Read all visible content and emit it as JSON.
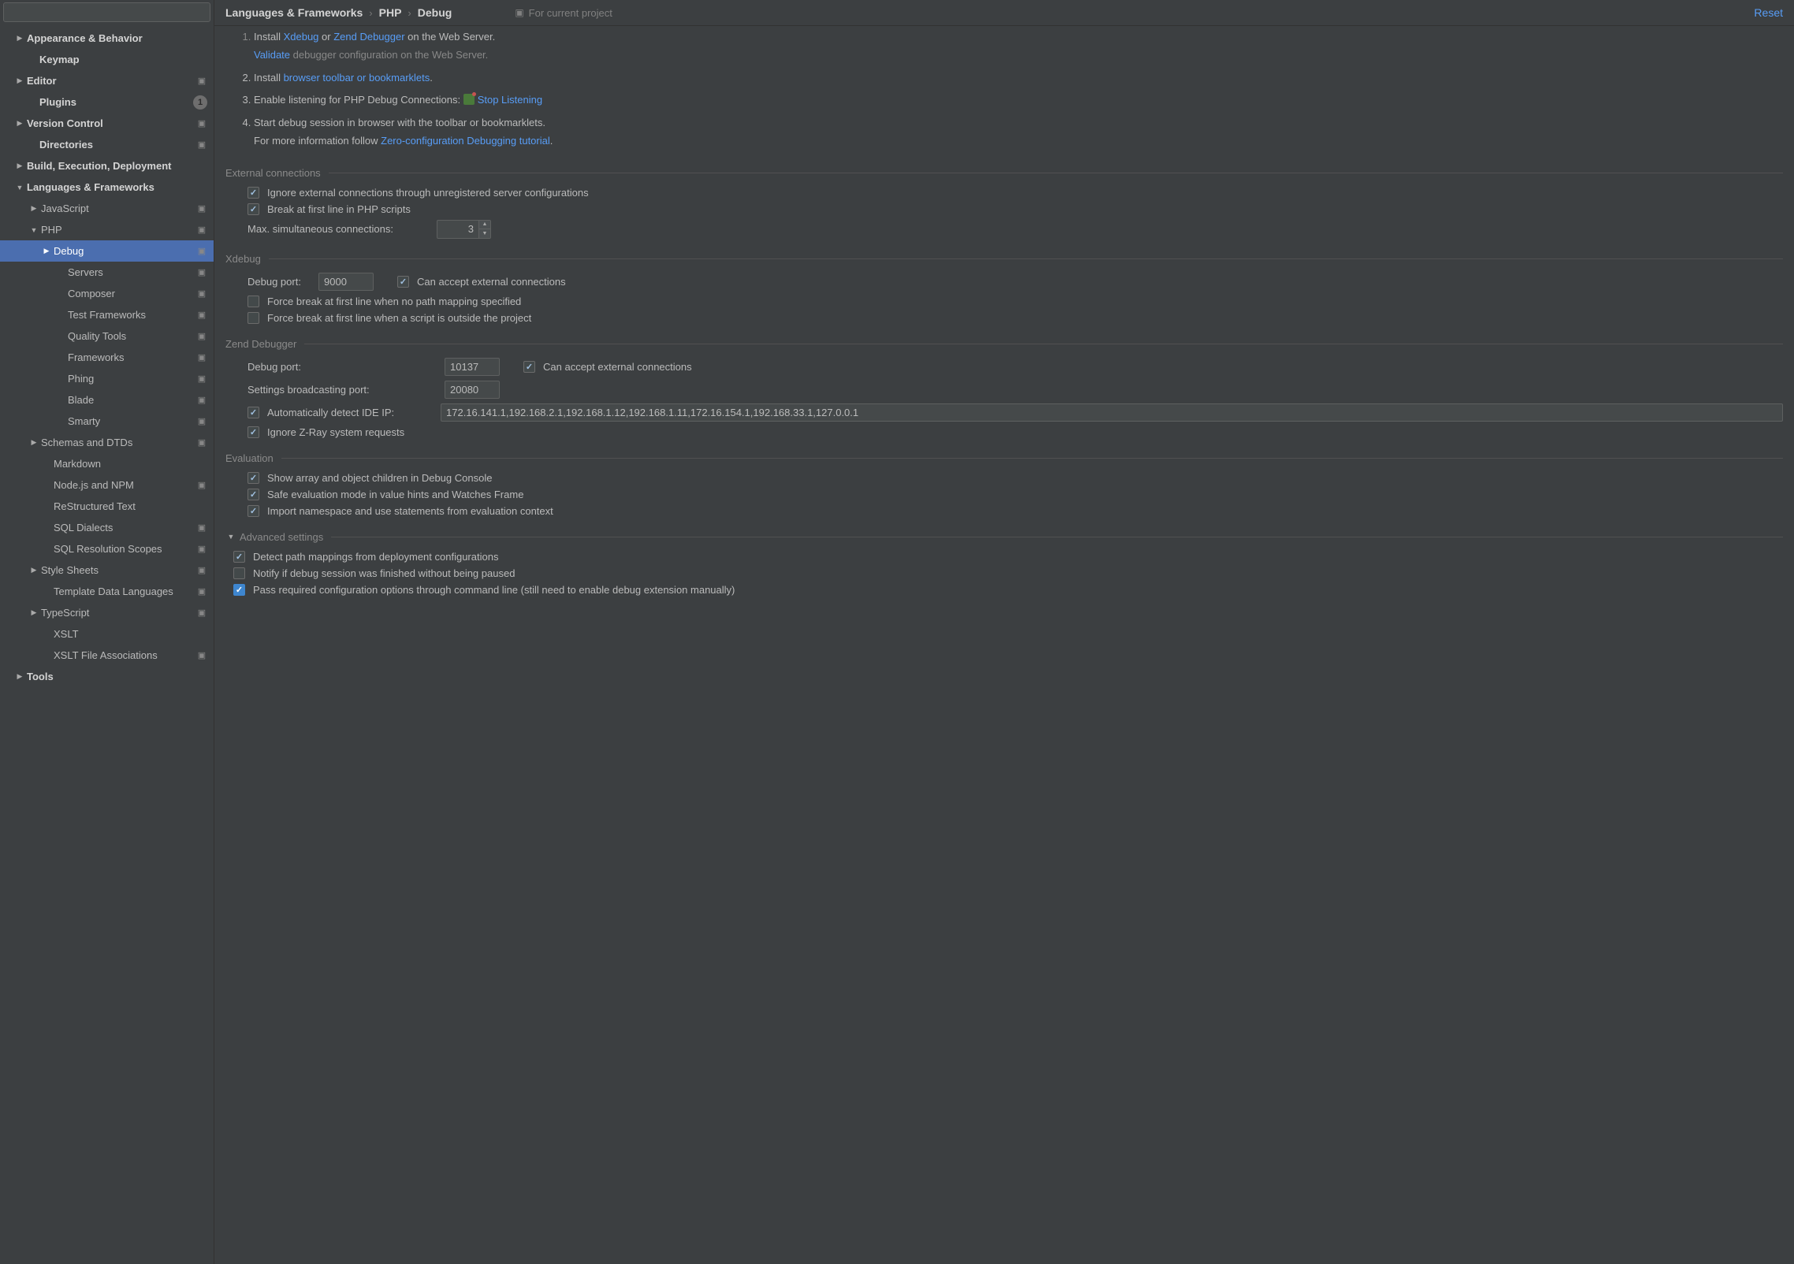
{
  "search": {
    "placeholder": ""
  },
  "sidebar": {
    "items": [
      {
        "label": "Appearance & Behavior",
        "indent": 18,
        "arrow": "▶",
        "bold": true
      },
      {
        "label": "Keymap",
        "indent": 34,
        "bold": true
      },
      {
        "label": "Editor",
        "indent": 18,
        "arrow": "▶",
        "bold": true,
        "marker": true
      },
      {
        "label": "Plugins",
        "indent": 34,
        "bold": true,
        "badge": "1"
      },
      {
        "label": "Version Control",
        "indent": 18,
        "arrow": "▶",
        "bold": true,
        "marker": true
      },
      {
        "label": "Directories",
        "indent": 34,
        "bold": true,
        "marker": true
      },
      {
        "label": "Build, Execution, Deployment",
        "indent": 18,
        "arrow": "▶",
        "bold": true
      },
      {
        "label": "Languages & Frameworks",
        "indent": 18,
        "arrow": "▼",
        "bold": true
      },
      {
        "label": "JavaScript",
        "indent": 36,
        "arrow": "▶",
        "marker": true
      },
      {
        "label": "PHP",
        "indent": 36,
        "arrow": "▼",
        "marker": true
      },
      {
        "label": "Debug",
        "indent": 52,
        "arrow": "▶",
        "selected": true,
        "marker": true
      },
      {
        "label": "Servers",
        "indent": 70,
        "marker": true
      },
      {
        "label": "Composer",
        "indent": 70,
        "marker": true
      },
      {
        "label": "Test Frameworks",
        "indent": 70,
        "marker": true
      },
      {
        "label": "Quality Tools",
        "indent": 70,
        "marker": true
      },
      {
        "label": "Frameworks",
        "indent": 70,
        "marker": true
      },
      {
        "label": "Phing",
        "indent": 70,
        "marker": true
      },
      {
        "label": "Blade",
        "indent": 70,
        "marker": true
      },
      {
        "label": "Smarty",
        "indent": 70,
        "marker": true
      },
      {
        "label": "Schemas and DTDs",
        "indent": 36,
        "arrow": "▶",
        "marker": true
      },
      {
        "label": "Markdown",
        "indent": 52
      },
      {
        "label": "Node.js and NPM",
        "indent": 52,
        "marker": true
      },
      {
        "label": "ReStructured Text",
        "indent": 52
      },
      {
        "label": "SQL Dialects",
        "indent": 52,
        "marker": true
      },
      {
        "label": "SQL Resolution Scopes",
        "indent": 52,
        "marker": true
      },
      {
        "label": "Style Sheets",
        "indent": 36,
        "arrow": "▶",
        "marker": true
      },
      {
        "label": "Template Data Languages",
        "indent": 52,
        "marker": true
      },
      {
        "label": "TypeScript",
        "indent": 36,
        "arrow": "▶",
        "marker": true
      },
      {
        "label": "XSLT",
        "indent": 52
      },
      {
        "label": "XSLT File Associations",
        "indent": 52,
        "marker": true
      },
      {
        "label": "Tools",
        "indent": 18,
        "arrow": "▶",
        "bold": true
      }
    ]
  },
  "header": {
    "crumbs": [
      "Languages & Frameworks",
      "PHP",
      "Debug"
    ],
    "note": "For current project",
    "reset": "Reset"
  },
  "steps": {
    "s1a": "Install ",
    "s1b": "Xdebug",
    "s1c": " or ",
    "s1d": "Zend Debugger",
    "s1e": " on the Web Server.",
    "s1v": "Validate",
    "s1vt": " debugger configuration on the Web Server.",
    "s2a": "Install ",
    "s2b": "browser toolbar or bookmarklets",
    "s2c": ".",
    "s3a": "Enable listening for PHP Debug Connections:  ",
    "s3b": "Stop Listening",
    "s4a": "Start debug session in browser with the toolbar or bookmarklets.",
    "s4b": "For more information follow ",
    "s4c": "Zero-configuration Debugging tutorial",
    "s4d": "."
  },
  "ext": {
    "title": "External connections",
    "ignore": "Ignore external connections through unregistered server configurations",
    "break": "Break at first line in PHP scripts",
    "maxLabel": "Max. simultaneous connections:",
    "maxValue": "3"
  },
  "xdebug": {
    "title": "Xdebug",
    "portLabel": "Debug port:",
    "port": "9000",
    "accept": "Can accept external connections",
    "f1": "Force break at first line when no path mapping specified",
    "f2": "Force break at first line when a script is outside the project"
  },
  "zend": {
    "title": "Zend Debugger",
    "portLabel": "Debug port:",
    "port": "10137",
    "accept": "Can accept external connections",
    "bcastLabel": "Settings broadcasting port:",
    "bcast": "20080",
    "autoIp": "Automatically detect IDE IP:",
    "ips": "172.16.141.1,192.168.2.1,192.168.1.12,192.168.1.11,172.16.154.1,192.168.33.1,127.0.0.1",
    "zray": "Ignore Z-Ray system requests"
  },
  "eval": {
    "title": "Evaluation",
    "e1": "Show array and object children in Debug Console",
    "e2": "Safe evaluation mode in value hints and Watches Frame",
    "e3": "Import namespace and use statements from evaluation context"
  },
  "adv": {
    "title": "Advanced settings",
    "a1": "Detect path mappings from deployment configurations",
    "a2": "Notify if debug session was finished without being paused",
    "a3": "Pass required configuration options through command line (still need to enable debug extension manually)"
  }
}
